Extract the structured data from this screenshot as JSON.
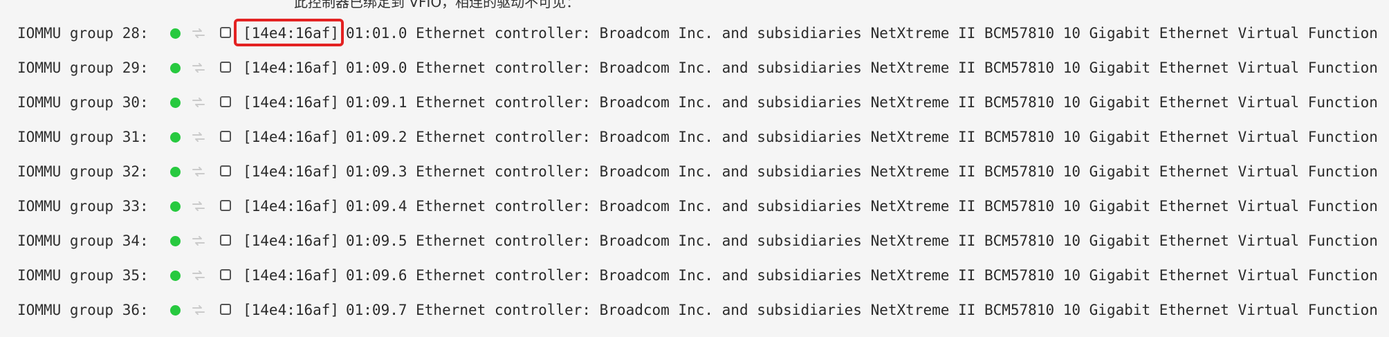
{
  "top_text": "此控制器已绑定到 VFIO，相连的驱动不可见：",
  "groups": [
    {
      "label": "IOMMU group 28:",
      "device_id": "[14e4:16af]",
      "description": "01:01.0 Ethernet controller: Broadcom Inc. and subsidiaries NetXtreme II BCM57810 10 Gigabit Ethernet Virtual Function",
      "checked": false,
      "status": "green"
    },
    {
      "label": "IOMMU group 29:",
      "device_id": "[14e4:16af]",
      "description": "01:09.0 Ethernet controller: Broadcom Inc. and subsidiaries NetXtreme II BCM57810 10 Gigabit Ethernet Virtual Function",
      "checked": false,
      "status": "green"
    },
    {
      "label": "IOMMU group 30:",
      "device_id": "[14e4:16af]",
      "description": "01:09.1 Ethernet controller: Broadcom Inc. and subsidiaries NetXtreme II BCM57810 10 Gigabit Ethernet Virtual Function",
      "checked": false,
      "status": "green"
    },
    {
      "label": "IOMMU group 31:",
      "device_id": "[14e4:16af]",
      "description": "01:09.2 Ethernet controller: Broadcom Inc. and subsidiaries NetXtreme II BCM57810 10 Gigabit Ethernet Virtual Function",
      "checked": false,
      "status": "green"
    },
    {
      "label": "IOMMU group 32:",
      "device_id": "[14e4:16af]",
      "description": "01:09.3 Ethernet controller: Broadcom Inc. and subsidiaries NetXtreme II BCM57810 10 Gigabit Ethernet Virtual Function",
      "checked": false,
      "status": "green"
    },
    {
      "label": "IOMMU group 33:",
      "device_id": "[14e4:16af]",
      "description": "01:09.4 Ethernet controller: Broadcom Inc. and subsidiaries NetXtreme II BCM57810 10 Gigabit Ethernet Virtual Function",
      "checked": false,
      "status": "green"
    },
    {
      "label": "IOMMU group 34:",
      "device_id": "[14e4:16af]",
      "description": "01:09.5 Ethernet controller: Broadcom Inc. and subsidiaries NetXtreme II BCM57810 10 Gigabit Ethernet Virtual Function",
      "checked": false,
      "status": "green"
    },
    {
      "label": "IOMMU group 35:",
      "device_id": "[14e4:16af]",
      "description": "01:09.6 Ethernet controller: Broadcom Inc. and subsidiaries NetXtreme II BCM57810 10 Gigabit Ethernet Virtual Function",
      "checked": false,
      "status": "green"
    },
    {
      "label": "IOMMU group 36:",
      "device_id": "[14e4:16af]",
      "description": "01:09.7 Ethernet controller: Broadcom Inc. and subsidiaries NetXtreme II BCM57810 10 Gigabit Ethernet Virtual Function",
      "checked": false,
      "status": "green"
    }
  ],
  "colors": {
    "status_green": "#27c93f",
    "highlight_red": "#e32222",
    "background": "#f5f5f5"
  },
  "icons": {
    "status": "status-dot-icon",
    "refresh": "refresh-icon",
    "checkbox": "checkbox-icon"
  }
}
